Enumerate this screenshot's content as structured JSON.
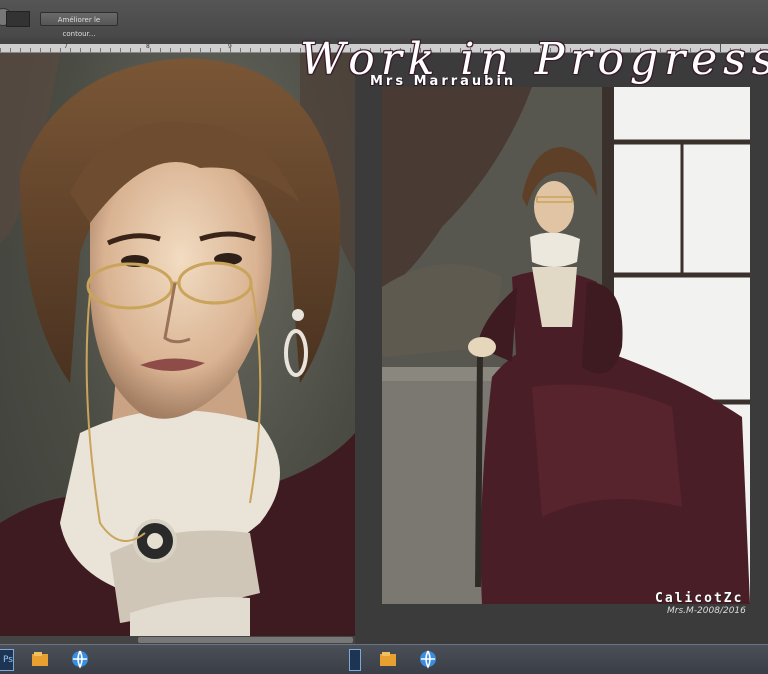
{
  "toolbar": {
    "refine_edge_label": "Améliorer le contour..."
  },
  "ruler": {
    "labels": [
      "7",
      "8",
      "9"
    ]
  },
  "artwork": {
    "title": "Work in Progress",
    "subtitle": "Mrs Marraubin",
    "signature": "CalicotZc",
    "credit": "Mrs.M-2008/2016"
  },
  "taskbar": {
    "ps_label": "Ps"
  },
  "colors": {
    "accent_title_outline": "#3a1a2a",
    "dress": "#4a1e26",
    "skin": "#e8c9a8",
    "hair": "#6b4a2e",
    "gold": "#c9a45a"
  }
}
